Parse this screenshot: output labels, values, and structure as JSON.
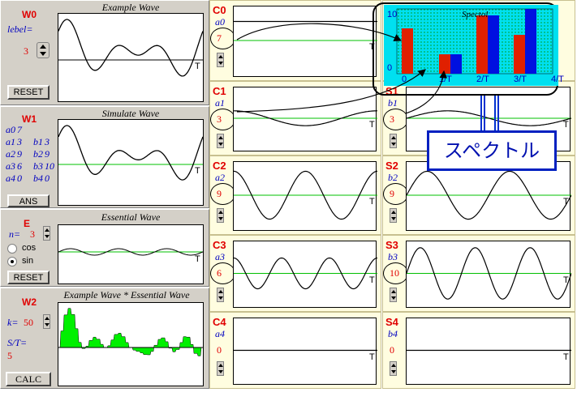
{
  "w0": {
    "title": "W0",
    "label_text": "lebel=",
    "level": "3",
    "plot_title": "Example Wave",
    "reset": "RESET"
  },
  "w1": {
    "title": "W1",
    "plot_title": "Simulate Wave",
    "ans": "ANS",
    "coeffs": [
      [
        "a0",
        "7",
        null,
        null
      ],
      [
        "a1",
        "3",
        "b1",
        "3"
      ],
      [
        "a2",
        "9",
        "b2",
        "9"
      ],
      [
        "a3",
        "6",
        "b3",
        "10"
      ],
      [
        "a4",
        "0",
        "b4",
        "0"
      ]
    ]
  },
  "e": {
    "title": "E",
    "n_label": "n=",
    "n_value": "3",
    "plot_title": "Essential Wave",
    "cos": "cos",
    "sin": "sin",
    "selected": "sin",
    "reset": "RESET"
  },
  "w2": {
    "title": "W2",
    "plot_title": "Example Wave * Essential Wave",
    "k_label": "k=",
    "k_value": "50",
    "st_label": "S/T=",
    "st_value": "5",
    "calc": "CALC"
  },
  "cols": [
    {
      "title": "C0",
      "sub": "a0",
      "value": "7"
    },
    {
      "title": "C1",
      "sub": "a1",
      "value": "3"
    },
    {
      "title": "C2",
      "sub": "a2",
      "value": "9"
    },
    {
      "title": "C3",
      "sub": "a3",
      "value": "6"
    },
    {
      "title": "C4",
      "sub": "a4",
      "value": "0"
    }
  ],
  "scol": [
    {
      "title": "S1",
      "sub": "b1",
      "value": "3"
    },
    {
      "title": "S2",
      "sub": "b2",
      "value": "9"
    },
    {
      "title": "S3",
      "sub": "b3",
      "value": "10"
    },
    {
      "title": "S4",
      "sub": "b4",
      "value": "0"
    }
  ],
  "t_label": "T",
  "spectrum": {
    "title": "Spectol",
    "callout": "スペクトル",
    "y_ticks": [
      "0",
      "10"
    ],
    "x_ticks": [
      "0",
      "1/T",
      "2/T",
      "3/T",
      "4/T"
    ],
    "a": [
      7,
      3,
      9,
      6,
      0
    ],
    "b": [
      0,
      3,
      9,
      10,
      0
    ],
    "colors": {
      "a": "#e02000",
      "b": "#0010e0"
    }
  },
  "colors": {
    "accent_red": "#e00000",
    "accent_blue": "#0000c0",
    "green": "#00c000",
    "cyan": "#00e0f0"
  }
}
